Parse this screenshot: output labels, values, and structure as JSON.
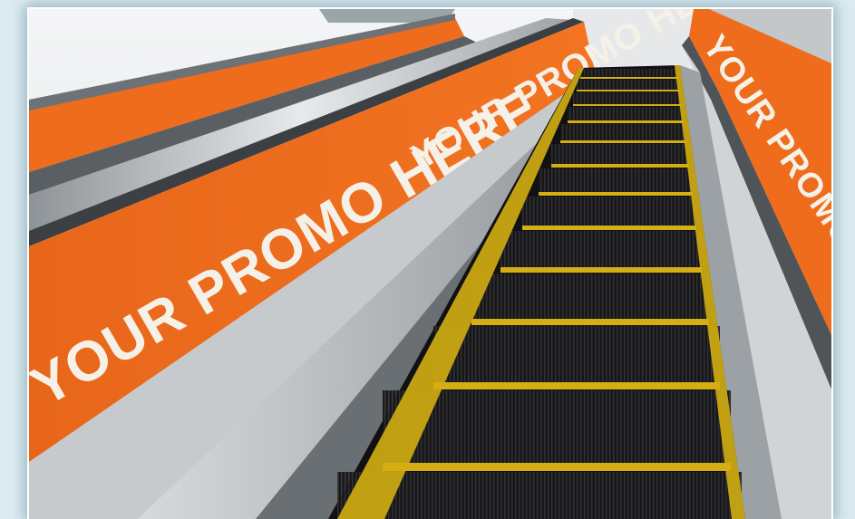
{
  "scene": {
    "description_tag": "escalator-advertising-mockup",
    "colors": {
      "page_background": "#dcebf1",
      "promo_orange": "#ee6c1c",
      "step_black": "#1e1e20",
      "step_edge_yellow": "#f2c615",
      "metal": "#c9ced2"
    },
    "left_wall": {
      "near_banner_text": "YOUR PROMO HERE",
      "mid_banner_text": "YOUR PROMO HERE"
    },
    "right_wall": {
      "banner_text": "YOUR PROMO HERE"
    }
  }
}
